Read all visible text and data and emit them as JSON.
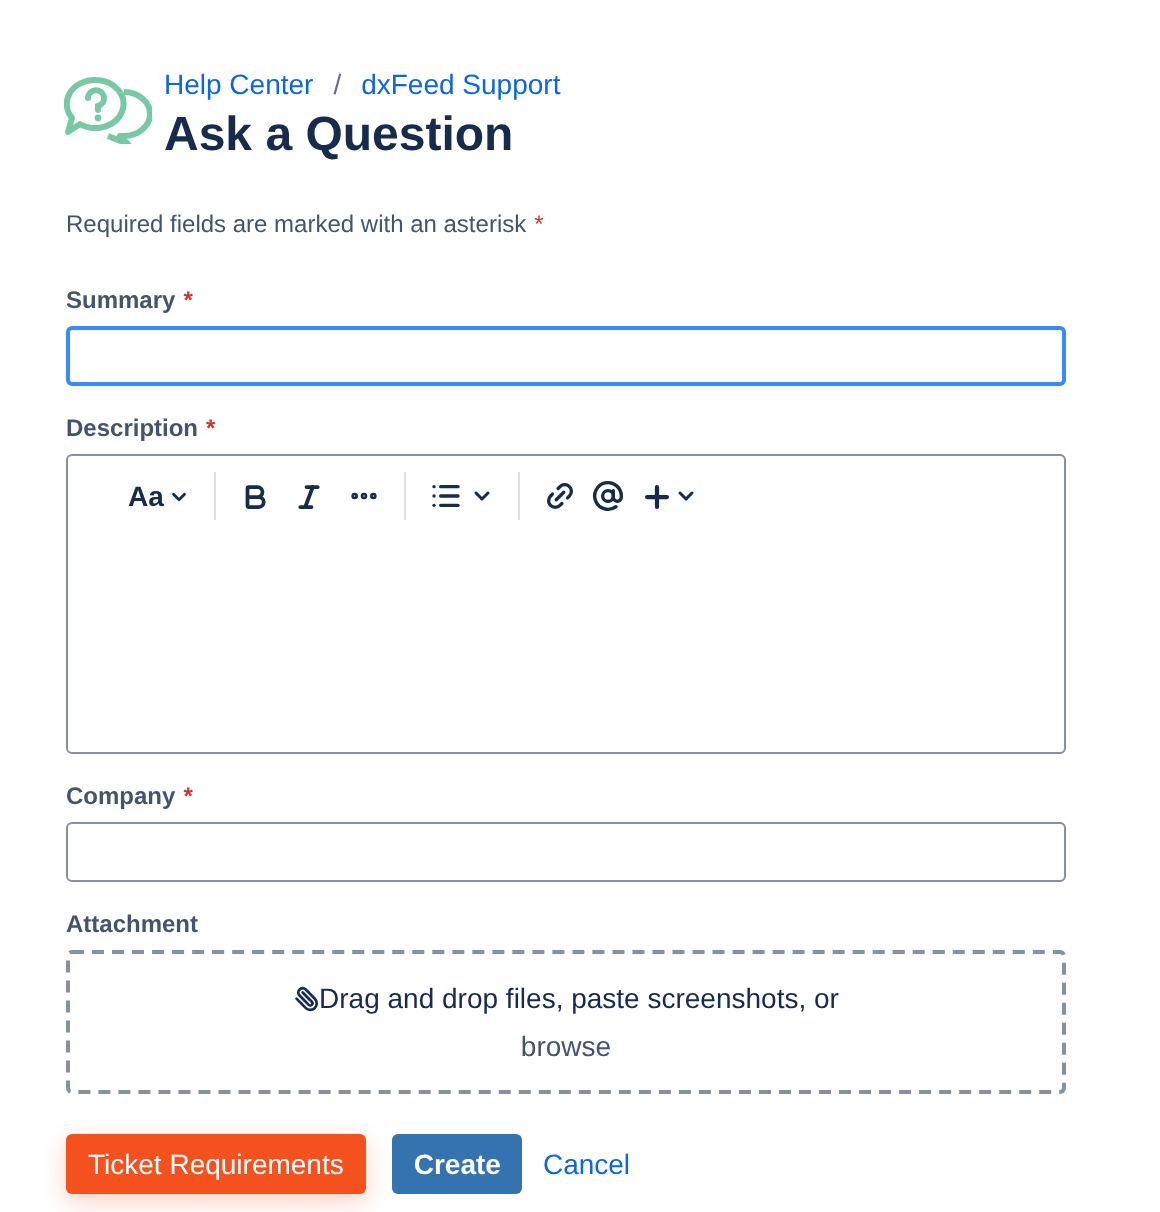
{
  "breadcrumbs": [
    "Help Center",
    "dxFeed Support"
  ],
  "breadcrumb_separator": "/",
  "title": "Ask a Question",
  "required_note": {
    "text": "Required fields are marked with an asterisk",
    "mark": "*"
  },
  "fields": [
    {
      "kind": "text",
      "label": "Summary",
      "required": true,
      "focused": true
    },
    {
      "kind": "editor",
      "label": "Description",
      "required": true,
      "focused": false,
      "toolbar": {
        "text_style": "Aa"
      }
    },
    {
      "kind": "text",
      "label": "Company",
      "required": true,
      "focused": false
    },
    {
      "kind": "attachment",
      "label": "Attachment",
      "required": false,
      "focused": false,
      "prompt": "Drag and drop files, paste screenshots, or",
      "link": "browse"
    }
  ],
  "buttons": [
    {
      "kind": "warning",
      "label": "Ticket Requirements"
    },
    {
      "kind": "primary",
      "label": "Create"
    },
    {
      "kind": "link",
      "label": "Cancel"
    }
  ]
}
